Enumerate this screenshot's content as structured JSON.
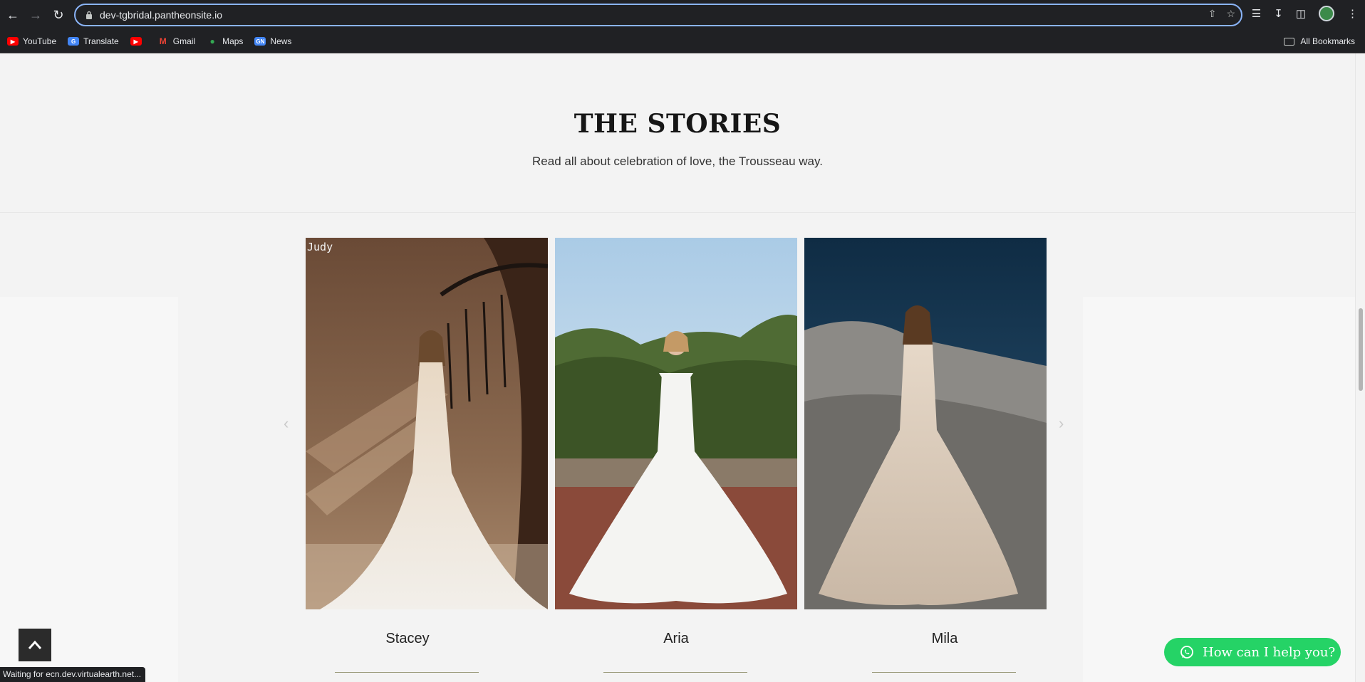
{
  "browser": {
    "url": "dev-tgbridal.pantheonsite.io",
    "bookmarks": [
      {
        "label": "YouTube",
        "icon": "youtube-icon"
      },
      {
        "label": "Translate",
        "icon": "translate-icon"
      },
      {
        "label": "",
        "icon": "youtube-icon"
      },
      {
        "label": "Gmail",
        "icon": "gmail-icon"
      },
      {
        "label": "Maps",
        "icon": "maps-icon"
      },
      {
        "label": "News",
        "icon": "news-icon"
      }
    ],
    "all_bookmarks": "All Bookmarks",
    "status_text": "Waiting for ecn.dev.virtualearth.net..."
  },
  "section": {
    "title": "THE STORIES",
    "subtitle": "Read all about celebration of love, the Trousseau way."
  },
  "stories": [
    {
      "name": "Stacey",
      "image_overlay": "Judy"
    },
    {
      "name": "Aria"
    },
    {
      "name": "Mila"
    }
  ],
  "chat": {
    "label": "How can I help you?"
  },
  "colors": {
    "chat_green": "#25d366",
    "page_bg": "#f3f3f3",
    "chrome_bg": "#202124"
  }
}
